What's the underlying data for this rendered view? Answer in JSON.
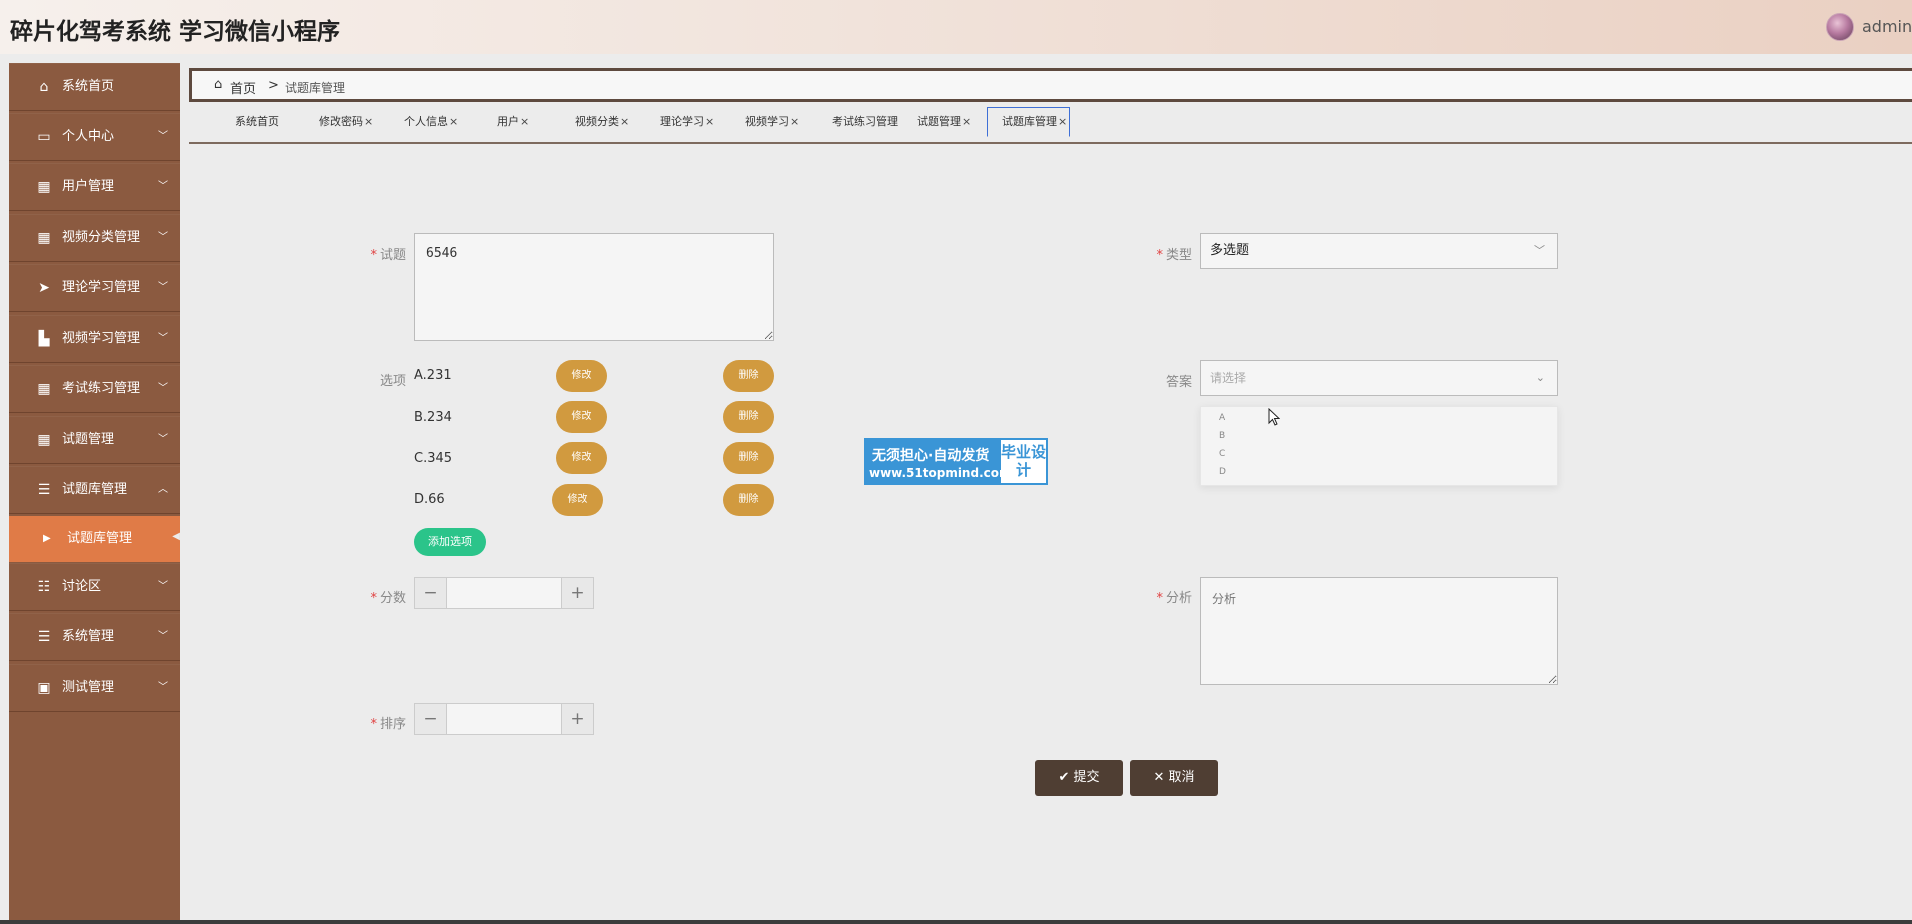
{
  "app": {
    "title": "碎片化驾考系统 学习微信小程序",
    "username": "admin"
  },
  "sidebar": {
    "items": [
      {
        "label": "系统首页",
        "icon": "home-icon"
      },
      {
        "label": "个人中心",
        "icon": "id-card-icon"
      },
      {
        "label": "用户管理",
        "icon": "grid-icon"
      },
      {
        "label": "视频分类管理",
        "icon": "grid-icon"
      },
      {
        "label": "理论学习管理",
        "icon": "paper-plane-icon"
      },
      {
        "label": "视频学习管理",
        "icon": "thumbs-up-icon"
      },
      {
        "label": "考试练习管理",
        "icon": "grid-icon"
      },
      {
        "label": "试题管理",
        "icon": "grid-icon"
      },
      {
        "label": "试题库管理",
        "icon": "list-icon"
      },
      {
        "label": "讨论区",
        "icon": "sliders-icon"
      },
      {
        "label": "系统管理",
        "icon": "list-icon"
      },
      {
        "label": "测试管理",
        "icon": "clipboard-icon"
      }
    ],
    "active_sub": "试题库管理"
  },
  "breadcrumb": {
    "home": "首页",
    "separator": ">",
    "current": "试题库管理"
  },
  "tabs": [
    {
      "label": "系统首页",
      "closable": false
    },
    {
      "label": "修改密码",
      "closable": true
    },
    {
      "label": "个人信息",
      "closable": true
    },
    {
      "label": "用户",
      "closable": true
    },
    {
      "label": "视频分类",
      "closable": true
    },
    {
      "label": "理论学习",
      "closable": true
    },
    {
      "label": "视频学习",
      "closable": true
    },
    {
      "label": "考试练习管理",
      "closable": false
    },
    {
      "label": "试题管理",
      "closable": true
    },
    {
      "label": "试题库管理",
      "closable": true,
      "active": true
    }
  ],
  "form": {
    "question_label": "试题",
    "question_value": "6546",
    "type_label": "类型",
    "type_value": "多选题",
    "options_label": "选项",
    "options": [
      "A.231",
      "B.234",
      "C.345",
      "D.66"
    ],
    "edit_label": "修改",
    "delete_label": "删除",
    "add_option_label": "添加选项",
    "answer_label": "答案",
    "answer_placeholder": "请选择",
    "answer_choices": [
      "A",
      "B",
      "C",
      "D"
    ],
    "score_label": "分数",
    "analysis_label": "分析",
    "analysis_placeholder": "分析",
    "sort_label": "排序",
    "submit_label": "提交",
    "cancel_label": "取消"
  },
  "watermark": {
    "line1": "无须担心·自动发货",
    "line2": "www.51topmind.com",
    "box": "毕业设计"
  },
  "colors": {
    "sidebar": "#8b5a40",
    "active_sub": "#e07b47",
    "pill": "#d19a3f",
    "add_option": "#2bc48a",
    "button": "#4f3e33"
  }
}
